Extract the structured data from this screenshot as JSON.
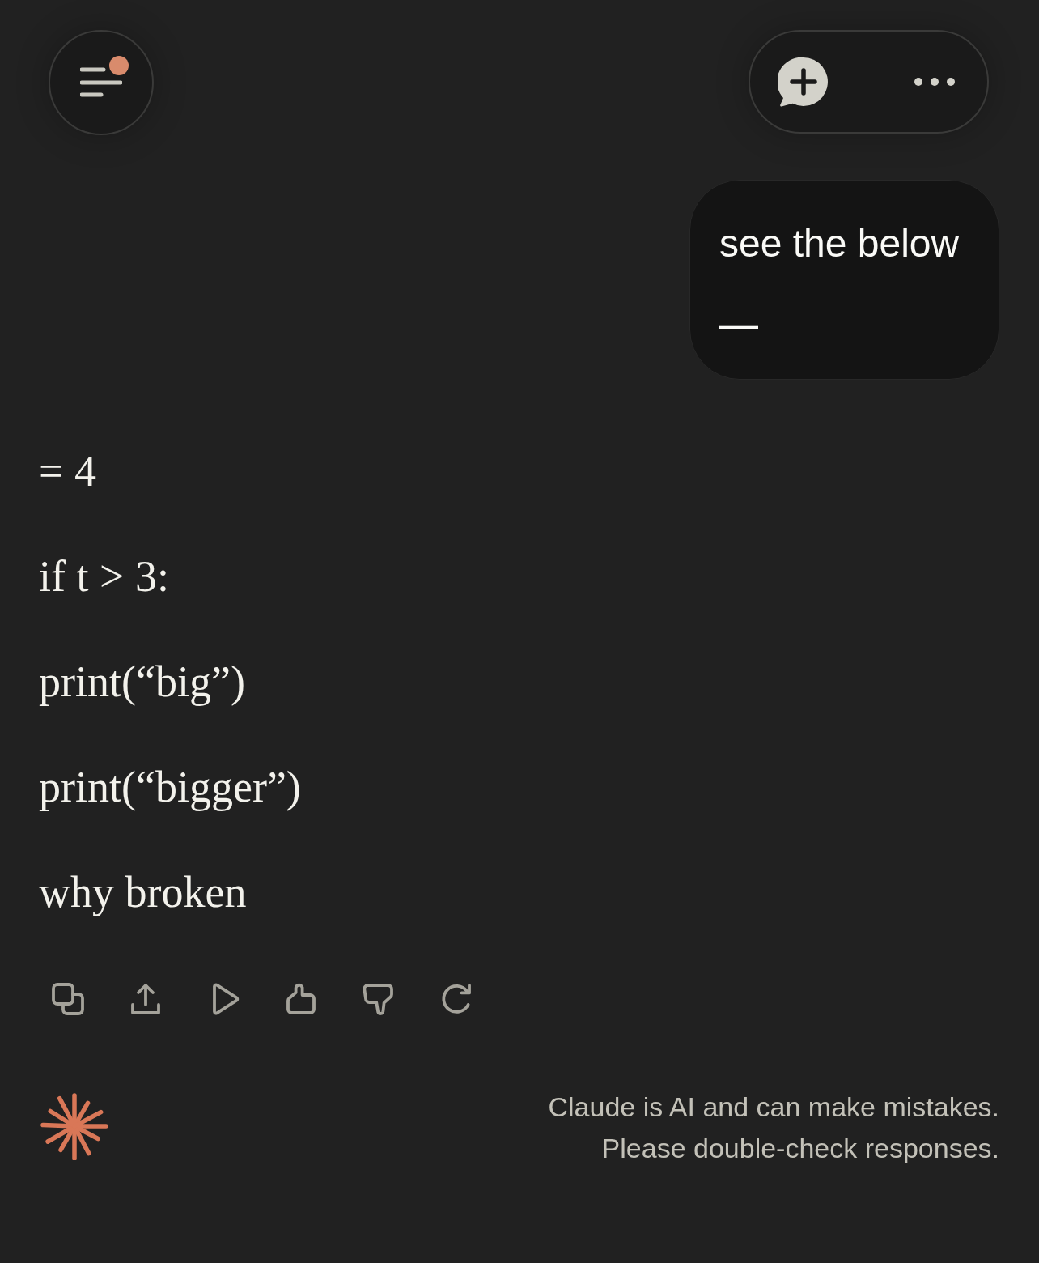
{
  "header": {
    "menu_button": {
      "unread": true
    }
  },
  "user_message": {
    "lines": [
      "see the below",
      "—"
    ]
  },
  "response": {
    "paragraphs": [
      "= 4",
      "if t > 3:",
      "print(“big”)",
      "print(“bigger”)",
      "why broken"
    ]
  },
  "footer": {
    "disclaimer_lines": [
      "Claude is AI and can make mistakes.",
      "Please double-check responses."
    ]
  }
}
